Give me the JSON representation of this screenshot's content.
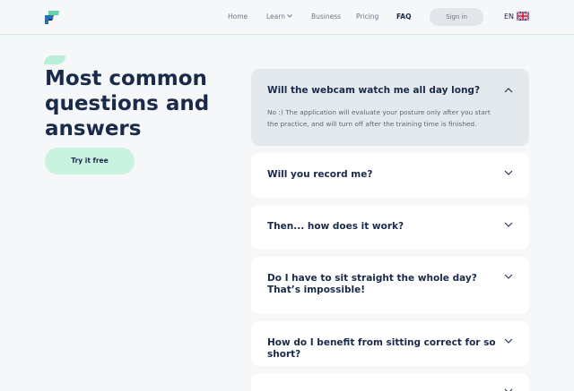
{
  "brand": {
    "logo_icon": "brand-logo-icon",
    "colors": {
      "accent": "#b7efd7",
      "cta": "#c9f2e0",
      "text": "#1a2a4a",
      "line": "#d4eee5"
    }
  },
  "nav": {
    "items": [
      {
        "label": "Home"
      },
      {
        "label": "Learn",
        "icon": "chevron-down-icon"
      },
      {
        "label": "Business"
      },
      {
        "label": "Pricing"
      },
      {
        "label": "FAQ",
        "active": true
      }
    ],
    "signin_label": "Sign in",
    "language": "EN",
    "flag_icon": "uk-flag-icon"
  },
  "hero": {
    "title": "Most common questions and answers",
    "cta_label": "Try it free"
  },
  "faq": [
    {
      "question": "Will the webcam watch me all day long?",
      "answer": "No :) The application will evaluate your posture only after you start the practice, and will turn off after the training time is finished.",
      "expanded": true,
      "icon": "chevron-up-icon"
    },
    {
      "question": "Will you record me?",
      "expanded": false,
      "icon": "chevron-down-icon"
    },
    {
      "question": "Then... how does it work?",
      "expanded": false,
      "icon": "chevron-down-icon"
    },
    {
      "question": "Do I have to sit straight the whole day? That’s impossible!",
      "expanded": false,
      "icon": "chevron-down-icon"
    },
    {
      "question": "How do I benefit from sitting correct for so short?",
      "expanded": false,
      "icon": "chevron-down-icon"
    }
  ]
}
